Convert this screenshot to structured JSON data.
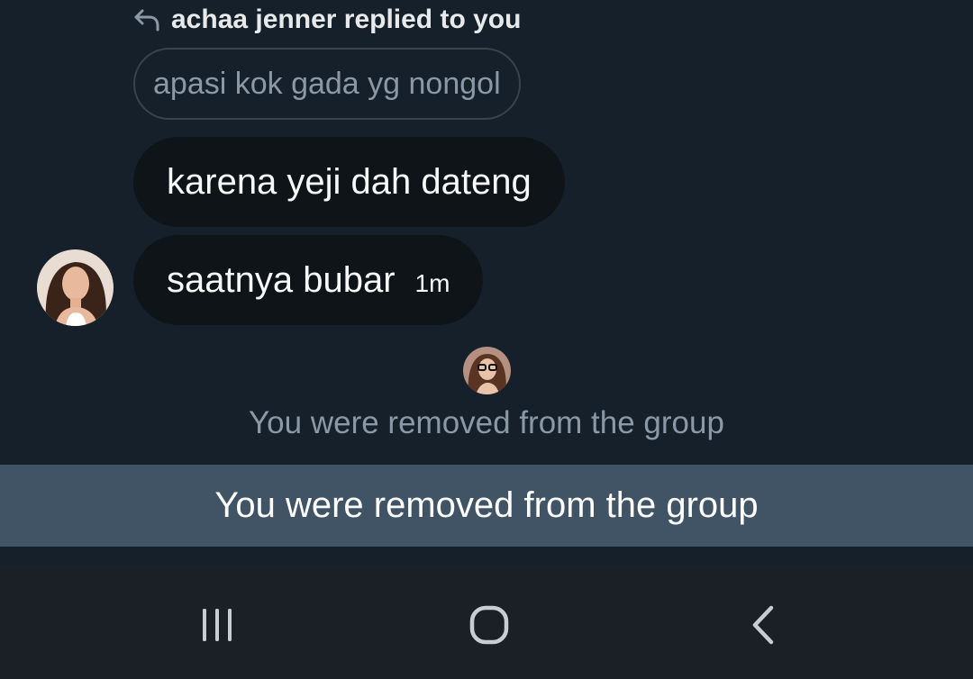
{
  "thread": {
    "reply_header": "achaa jenner replied to you",
    "quoted_text": "apasi kok gada yg nongol",
    "messages": [
      {
        "text": "karena yeji dah dateng"
      },
      {
        "text": "saatnya bubar",
        "time": "1m"
      }
    ],
    "system_message": "You were removed from the group"
  },
  "banner": {
    "text": "You were removed from the group"
  },
  "navbar": {
    "buttons": [
      "recent-apps",
      "home",
      "back"
    ]
  },
  "colors": {
    "background": "#15202b",
    "bubble": "#0f1419",
    "banner": "#405466",
    "navbar": "#1b2026",
    "muted_text": "#8b98a5"
  },
  "icons": [
    "reply-arrow-icon",
    "recent-apps-icon",
    "home-icon",
    "back-icon"
  ]
}
